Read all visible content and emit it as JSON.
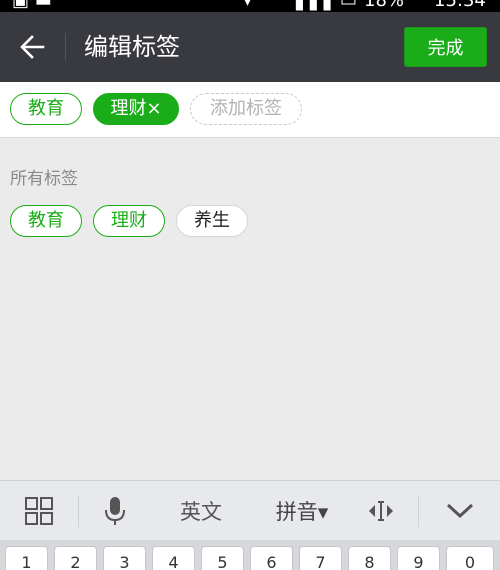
{
  "status_bar": {
    "battery": "18%",
    "time": "15:34"
  },
  "header": {
    "title": "编辑标签",
    "done_label": "完成"
  },
  "selected_tags": [
    {
      "label": "教育"
    },
    {
      "label": "理财×"
    }
  ],
  "add_tag_placeholder": "添加标签",
  "all_tags_title": "所有标签",
  "all_tags": [
    {
      "label": "教育"
    },
    {
      "label": "理财"
    },
    {
      "label": "养生"
    }
  ],
  "ime": {
    "english_label": "英文",
    "pinyin_label": "拼音▾"
  },
  "number_keys": [
    "1",
    "2",
    "3",
    "4",
    "5",
    "6",
    "7",
    "8",
    "9",
    "0"
  ],
  "colors": {
    "accent": "#1aad19",
    "header_bg": "#393a3f",
    "page_bg": "#ebebeb"
  }
}
